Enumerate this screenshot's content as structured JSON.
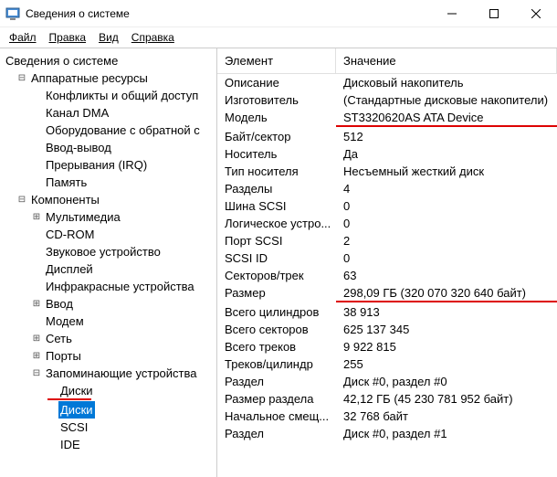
{
  "titlebar": {
    "title": "Сведения о системе"
  },
  "menu": {
    "file": "Файл",
    "edit": "Правка",
    "view": "Вид",
    "help": "Справка"
  },
  "tree": {
    "root": "Сведения о системе",
    "hw": "Аппаратные ресурсы",
    "hw_items": {
      "conflicts": "Конфликты и общий доступ",
      "dma": "Канал DMA",
      "forced": "Оборудование с обратной с",
      "io": "Ввод-вывод",
      "irq": "Прерывания (IRQ)",
      "memory": "Память"
    },
    "components": "Компоненты",
    "comp_items": {
      "multimedia": "Мультимедиа",
      "cdrom": "CD-ROM",
      "sound": "Звуковое устройство",
      "display": "Дисплей",
      "infrared": "Инфракрасные устройства",
      "input": "Ввод",
      "modem": "Модем",
      "network": "Сеть",
      "ports": "Порты",
      "storage": "Запоминающие устройства",
      "drives": "Диски",
      "drives2": "Диски",
      "scsi": "SCSI",
      "ide": "IDE"
    }
  },
  "table": {
    "header": {
      "element": "Элемент",
      "value": "Значение"
    },
    "rows": [
      {
        "k": "Описание",
        "v": "Дисковый накопитель"
      },
      {
        "k": "Изготовитель",
        "v": "(Стандартные дисковые накопители)"
      },
      {
        "k": "Модель",
        "v": "ST3320620AS ATA Device",
        "hl": "model"
      },
      {
        "k": "Байт/сектор",
        "v": "512"
      },
      {
        "k": "Носитель",
        "v": "Да"
      },
      {
        "k": "Тип носителя",
        "v": "Несъемный жесткий диск"
      },
      {
        "k": "Разделы",
        "v": "4"
      },
      {
        "k": "Шина SCSI",
        "v": "0"
      },
      {
        "k": "Логическое устро...",
        "v": "0"
      },
      {
        "k": "Порт SCSI",
        "v": "2"
      },
      {
        "k": "SCSI ID",
        "v": "0"
      },
      {
        "k": "Секторов/трек",
        "v": "63"
      },
      {
        "k": "Размер",
        "v": "298,09 ГБ (320 070 320 640 байт)",
        "hl": "size"
      },
      {
        "k": "Всего цилиндров",
        "v": "38 913"
      },
      {
        "k": "Всего секторов",
        "v": "625 137 345"
      },
      {
        "k": "Всего треков",
        "v": "9 922 815"
      },
      {
        "k": "Треков/цилиндр",
        "v": "255"
      },
      {
        "k": "Раздел",
        "v": "Диск #0, раздел #0"
      },
      {
        "k": "Размер раздела",
        "v": "42,12 ГБ (45 230 781 952 байт)"
      },
      {
        "k": "Начальное смещ...",
        "v": "32 768 байт"
      },
      {
        "k": "Раздел",
        "v": "Диск #0, раздел #1"
      }
    ]
  }
}
